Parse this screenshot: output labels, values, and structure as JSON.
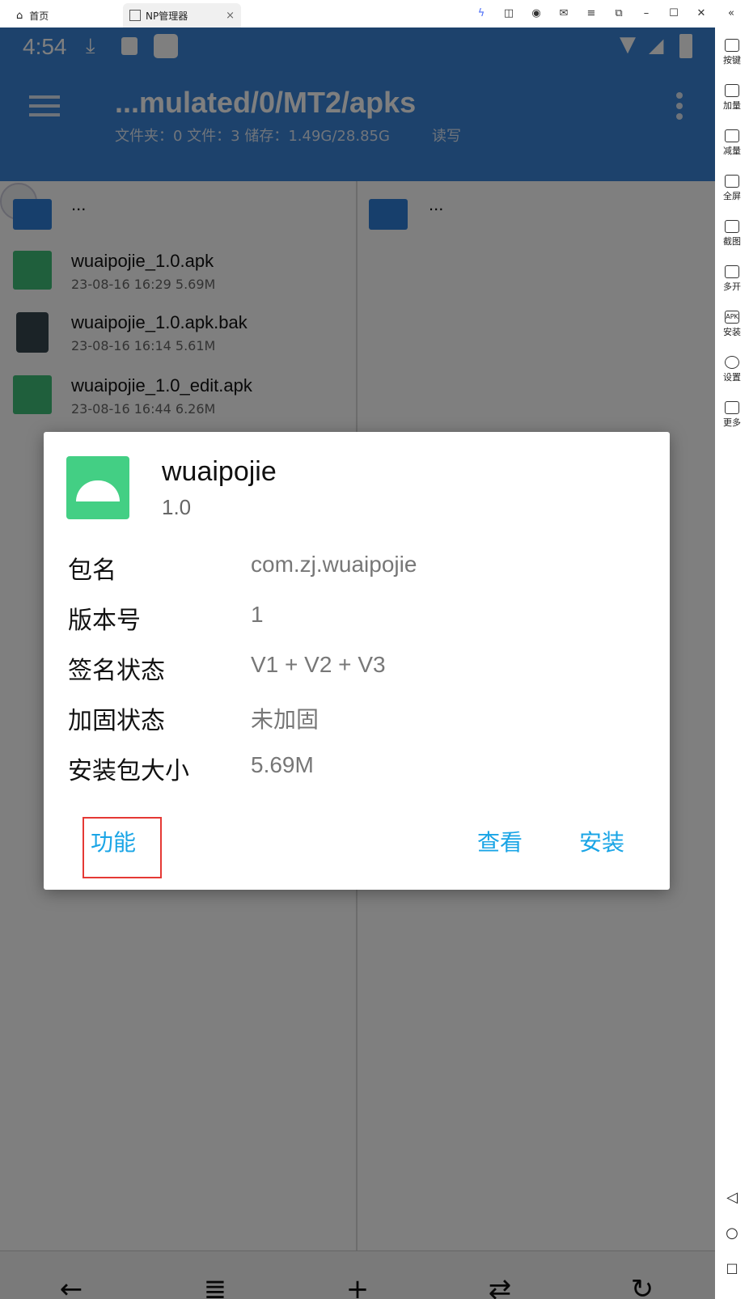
{
  "window": {
    "tab_home": "首页",
    "tab_app": "NP管理器",
    "tab_close": "×"
  },
  "sidebar": {
    "items": [
      {
        "label": "按键",
        "icon": "keyboard-icon"
      },
      {
        "label": "加量",
        "icon": "volume-up-icon"
      },
      {
        "label": "减量",
        "icon": "volume-down-icon"
      },
      {
        "label": "全屏",
        "icon": "fullscreen-icon"
      },
      {
        "label": "截图",
        "icon": "scissors-icon"
      },
      {
        "label": "多开",
        "icon": "multi-instance-icon"
      },
      {
        "label": "安装",
        "icon": "apk-install-icon"
      },
      {
        "label": "设置",
        "icon": "settings-icon"
      },
      {
        "label": "更多",
        "icon": "more-icon"
      }
    ],
    "apk_icon_text": "APK"
  },
  "status": {
    "time": "4:54"
  },
  "toolbar": {
    "path": "...mulated/0/MT2/apks",
    "info": "文件夹：0  文件：3  储存：1.49G/28.85G",
    "mode": "读写"
  },
  "left_pane": {
    "parent_label": "...",
    "files": [
      {
        "name": "wuaipojie_1.0.apk",
        "meta": "23-08-16 16:29  5.69M",
        "type": "apk"
      },
      {
        "name": "wuaipojie_1.0.apk.bak",
        "meta": "23-08-16 16:14  5.61M",
        "type": "file"
      },
      {
        "name": "wuaipojie_1.0_edit.apk",
        "meta": "23-08-16 16:44  6.26M",
        "type": "apk"
      }
    ]
  },
  "right_pane": {
    "parent_label": "..."
  },
  "dialog": {
    "app_name": "wuaipojie",
    "version": "1.0",
    "rows": [
      {
        "key": "包名",
        "value": "com.zj.wuaipojie"
      },
      {
        "key": "版本号",
        "value": "1"
      },
      {
        "key": "签名状态",
        "value": "V1 + V2 + V3"
      },
      {
        "key": "加固状态",
        "value": "未加固"
      },
      {
        "key": "安装包大小",
        "value": "5.69M"
      }
    ],
    "btn_function": "功能",
    "btn_view": "查看",
    "btn_install": "安装"
  },
  "colors": {
    "accent": "#3a85d8",
    "button_text": "#1aa5e6",
    "highlight_box": "#e53935",
    "apk_green": "#3fbf78"
  }
}
